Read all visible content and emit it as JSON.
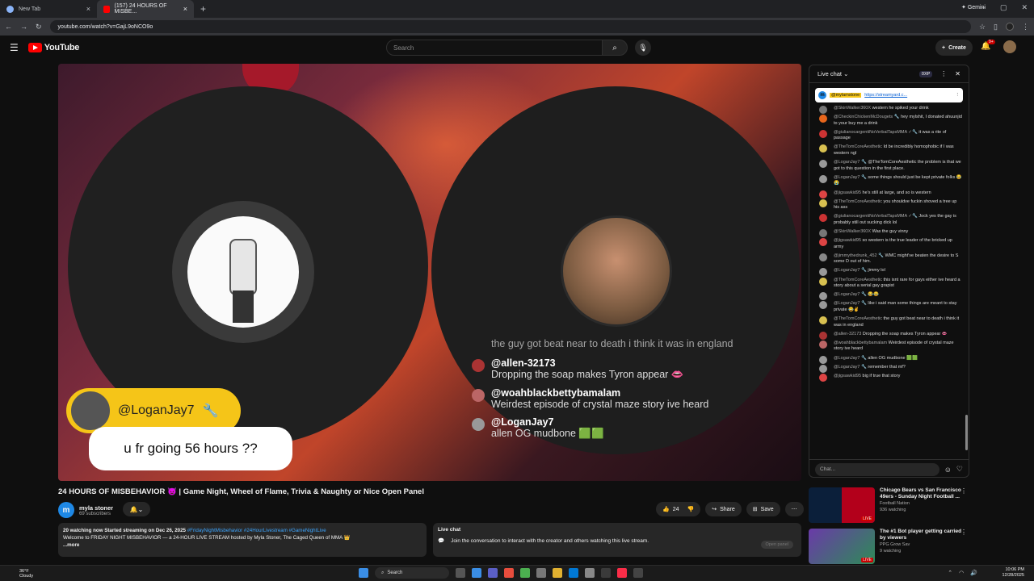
{
  "browser": {
    "tabs": [
      {
        "title": "New Tab"
      },
      {
        "title": "(157) 24 HOURS OF MISBE..."
      }
    ],
    "gemini_label": "Gemini",
    "url": "youtube.com/watch?v=GajL9oNCO9o"
  },
  "youtube": {
    "logo_text": "YouTube",
    "search_placeholder": "Search",
    "create_label": "Create",
    "notif_count": "9+"
  },
  "overlay": {
    "faded_msg": "the guy got beat near to death i think it was in england",
    "messages": [
      {
        "author": "@allen-32173",
        "text": "Dropping the soap makes Tyron appear 👄"
      },
      {
        "author": "@woahblackbettybamalam",
        "text": "Weirdest episode of crystal maze story ive heard"
      },
      {
        "author": "@LoganJay7",
        "text": "allen OG mudbone 🟩🟩"
      }
    ],
    "featured_name": "@LoganJay7",
    "featured_msg": "u fr going 56 hours ??"
  },
  "video": {
    "title": "24 HOURS OF MISBEHAVIOR 👿 | Game Night, Wheel of Flame, Trivia & Naughty or Nice Open Panel",
    "channel": "myla stoner",
    "subs": "69 subscribers",
    "likes": "24",
    "share": "Share",
    "save": "Save",
    "desc_stats": "20 watching now  Started streaming on Dec 26, 2025",
    "desc_tags": "#FridayNightMisbehavior #24HourLivestream #GameNightLive",
    "desc_text": "Welcome to FRIDAY NIGHT MISBEHAVIOR — a 24-HOUR LIVE STREAM hosted by Myla Stoner, The Caged Queen of MMA 👑",
    "desc_more": "...more"
  },
  "live_box": {
    "title": "Live chat",
    "join": "Join the conversation to interact with the creator and others watching this live stream.",
    "open_panel": "Open panel"
  },
  "live_chat": {
    "title": "Live chat",
    "xp": "0XP",
    "pinned_user": "@mylamstone",
    "pinned_link": "https://streamyard.c...",
    "input_placeholder": "Chat...",
    "messages": [
      {
        "user": "@SkinWalker360X",
        "text": "western he spiked your drink",
        "color": "#777"
      },
      {
        "user": "@CheckinChickenMcDougets 🔧",
        "text": "hey mylshit, I donated ahuunjid to your buy me a drink",
        "color": "#e8661c"
      },
      {
        "user": "@giulianocargentiNoVerbalTapsMMA ✓🔧",
        "text": "it was a rite of passage",
        "color": "#c33"
      },
      {
        "user": "@TheTomCoreAesthetic",
        "text": "Id be incredibly homophobic if I was western ngl",
        "color": "#d8c050"
      },
      {
        "user": "@LoganJay7 🔧",
        "text": "@TheTomCoreAesthetic the problem is that we got to this question in the first place.",
        "color": "#999"
      },
      {
        "user": "@LoganJay7 🔧",
        "text": "some things should just be kept private folks 😂😭",
        "color": "#999"
      },
      {
        "user": "@jigsawkid95",
        "text": "he's still at large, and so is western",
        "color": "#d44"
      },
      {
        "user": "@TheTomCoreAesthetic",
        "text": "you shouldve fuckin shoved a tree up his ass",
        "color": "#d8c050"
      },
      {
        "user": "@giulianocargentiNoVerbalTapsMMA ✓🔧",
        "text": "Jock yes the gay is probably still out sucking dick lol",
        "color": "#c33"
      },
      {
        "user": "@SkinWalker360X",
        "text": "Was the guy vinny",
        "color": "#777"
      },
      {
        "user": "@jigsawkid95",
        "text": "so western is the true leader of the bricked up army",
        "color": "#d44"
      },
      {
        "user": "@jimmythedrunk_452 🔧",
        "text": "WMC might've beaten the desire to S some D out of him.",
        "color": "#888"
      },
      {
        "user": "@LoganJay7 🔧",
        "text": "jimmy lol",
        "color": "#999"
      },
      {
        "user": "@TheTomCoreAesthetic",
        "text": "this isnt rare for gays either ive heard a story about a serial gay grapist",
        "color": "#d8c050"
      },
      {
        "user": "@LoganJay7 🔧",
        "text": "😂😂",
        "color": "#999"
      },
      {
        "user": "@LoganJay7 🔧",
        "text": "like i said man some things are meant to stay private 😂✌",
        "color": "#999"
      },
      {
        "user": "@TheTomCoreAesthetic",
        "text": "the guy got beat near to death i think it was in england",
        "color": "#d8c050"
      },
      {
        "user": "@allen-32173",
        "text": "Dropping the soap makes Tyron appear 👄",
        "color": "#a33"
      },
      {
        "user": "@woahblackbettybamalam",
        "text": "Weirdest episode of crystal maze story ive heard",
        "color": "#b66"
      },
      {
        "user": "@LoganJay7 🔧",
        "text": "allen OG mudbone 🟩🟩",
        "color": "#999"
      },
      {
        "user": "@LoganJay7 🔧",
        "text": "remember that mf?",
        "color": "#999"
      },
      {
        "user": "@jigsawkid95",
        "text": "big if true that story",
        "color": "#d44"
      }
    ]
  },
  "recommendations": [
    {
      "title": "Chicago Bears vs San Francisco 49ers - Sunday Night Football ...",
      "channel": "Football Nation",
      "stat": "936 watching",
      "live": "LIVE"
    },
    {
      "title": "The #1 Bot player getting carried by viewers",
      "channel": "PPG Grow Sav",
      "stat": "9 watching",
      "live": "LIVE"
    }
  ],
  "taskbar": {
    "temp": "36°F",
    "weather": "Cloudy",
    "search": "Search",
    "time": "10:06 PM",
    "date": "12/28/2025"
  }
}
